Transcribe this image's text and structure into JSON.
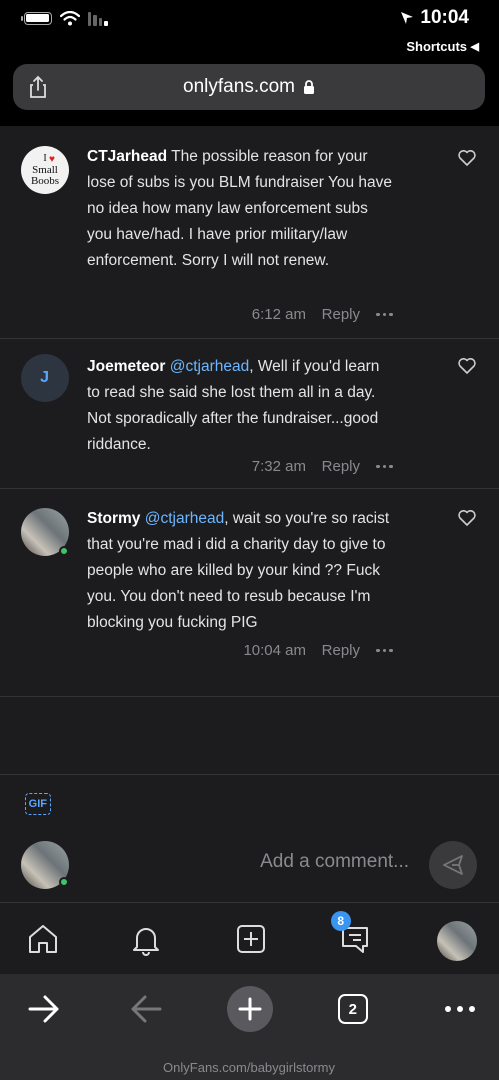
{
  "status_bar": {
    "time": "10:04"
  },
  "browser": {
    "back_to_app": "Shortcuts",
    "url": "onlyfans.com",
    "tab_count": "2",
    "footer_url": "OnlyFans.com/babygirlstormy"
  },
  "avatars": {
    "joemeteor_initial": "J",
    "ctjarhead_sign_line1": "I",
    "ctjarhead_sign_line2": "Small",
    "ctjarhead_sign_line3": "Boobs"
  },
  "comments": [
    {
      "author": "CTJarhead",
      "text": "The possible reason for your lose of subs is you BLM fundraiser You have no idea how many law enforcement subs you have/had. I have prior military/law enforcement. Sorry I will not renew.",
      "time": "6:12 am",
      "reply": "Reply"
    },
    {
      "author": "Joemeteor",
      "mention": "@ctjarhead",
      "text": ", Well if you'd learn to read she said she lost them all in a day. Not sporadically after the fundraiser...good riddance.",
      "time": "7:32 am",
      "reply": "Reply"
    },
    {
      "author": "Stormy",
      "mention": "@ctjarhead",
      "text": ", wait so you're so racist that you're mad i did a charity day to give to people who are killed by your kind ?? Fuck you. You don't need to resub because I'm blocking you fucking PIG",
      "time": "10:04 am",
      "reply": "Reply"
    }
  ],
  "composer": {
    "placeholder": "Add a comment...",
    "gif_label": "GIF"
  },
  "tabbar": {
    "messages_badge": "8"
  },
  "colors": {
    "accent": "#3a95f0",
    "mention": "#6cb6ff",
    "online": "#3ec46d",
    "background": "#1c1c1e"
  }
}
